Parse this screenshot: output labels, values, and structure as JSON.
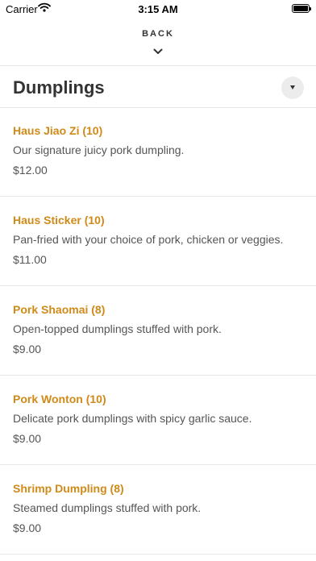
{
  "status_bar": {
    "carrier": "Carrier",
    "time": "3:15 AM",
    "wifi_icon": "wifi-icon",
    "battery_icon": "battery-icon"
  },
  "nav": {
    "back_label": "BACK",
    "chevron_icon": "chevron-down-icon"
  },
  "category": {
    "title": "Dumplings",
    "toggle_icon": "caret-down-icon"
  },
  "colors": {
    "item_name": "#d08a18",
    "text": "#555555",
    "title": "#333333",
    "divider": "#e8e8e8"
  },
  "items": [
    {
      "name": "Haus Jiao Zi (10)",
      "description": "Our signature juicy pork dumpling.",
      "price": "$12.00"
    },
    {
      "name": "Haus Sticker (10)",
      "description": "Pan-fried with your choice of pork, chicken or veggies.",
      "price": "$11.00"
    },
    {
      "name": "Pork Shaomai (8)",
      "description": "Open-topped dumplings stuffed with pork.",
      "price": "$9.00"
    },
    {
      "name": "Pork Wonton (10)",
      "description": "Delicate pork dumplings with spicy garlic sauce.",
      "price": "$9.00"
    },
    {
      "name": "Shrimp Dumpling (8)",
      "description": "Steamed dumplings stuffed with pork.",
      "price": "$9.00"
    }
  ]
}
